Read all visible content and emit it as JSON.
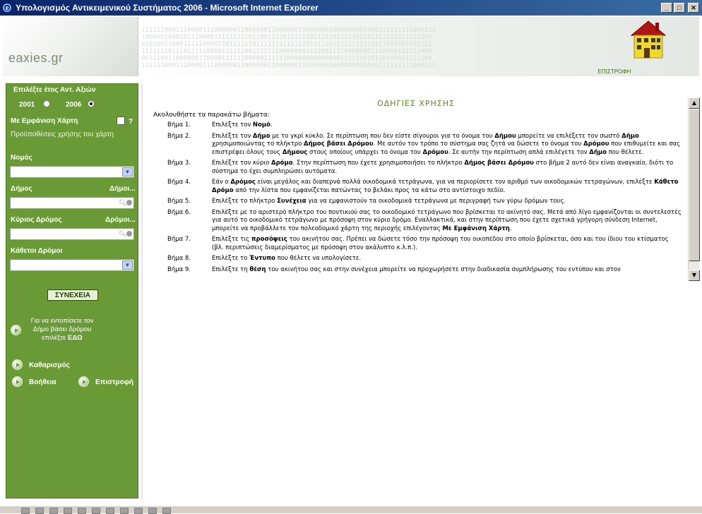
{
  "window": {
    "title": "Υπολογισμός Αντικειμενικού Συστήματος 2006 - Microsoft Internet Explorer",
    "buttons": [
      "minimize",
      "maximize",
      "close"
    ]
  },
  "header": {
    "logo": "eaxies.gr",
    "return_label": "ΕΠΙΣΤΡΟΦΗ",
    "binary_text": "11111100011100001110000001100000011000000110000001000000001000111111111000111\n1000001000101110000111111111011001111011111101111101111101111111111011111100\n0101001100011111000011011111101111111111111011111011111111110111000101001111\n1111111011101111100001111110011111110000000111100111100000001110000111111000\n0011100110000001100001111110000011111100000000000000111111010110100011111100\n11111100011100001110000001100000011000000110000001000000001000111111111000111"
  },
  "sidebar": {
    "year_label": "Επιλέξτε έτος Αντ. Αξιών",
    "year_2001": "2001",
    "year_2006": "2006",
    "selected_year": "2006",
    "map_label": "Με Εμφάνιση Χάρτη",
    "map_help": "?",
    "map_prereq": "Προϋποθέσεις χρήσης του χάρτη",
    "nomos_label": "Νομός",
    "dimos_label": "Δήμος",
    "dimos_link": "Δήμοι...",
    "road_label": "Κύριος Δρόμος",
    "road_link": "Δρόμοι...",
    "cross_label": "Κάθετοι Δρόμοι",
    "continue_label": "ΣΥΝΕΧΕΙΑ",
    "locate_text_1": "Για να εντοπίσετε τον",
    "locate_text_2": "Δήμο βάσει δρόμου",
    "locate_text_3": "επιλέξτε",
    "locate_link": "ΕΔΩ",
    "clear_label": "Καθαρισμός",
    "help_label": "Βοήθεια",
    "return_label": "Επιστροφή"
  },
  "content": {
    "title": "ΟΔΗΓΙΕΣ ΧΡΗΣΗΣ",
    "intro": "Ακολουθήστε τα παρακάτω βήματα:",
    "steps": [
      {
        "num": "Βήμα 1.",
        "html": "Επιλέξτε τον <b>Νομό</b>."
      },
      {
        "num": "Βήμα 2.",
        "html": "Επιλέξτε τον <b>Δήμο</b> με το γκρί κύκλο. Σε περίπτωση που δεν είστε σίγουροι για το όνομα του <b>Δήμου</b> μπορείτε να επιλέξετε τον σωστό <b>Δήμο</b> χρησιμοποιώντας το πλήκτρο <b>Δήμος βάσει Δρόμου</b>. Με αυτόν τον τρόπο το σύστημα σας ζητά να δώσετε το όνομα του <b>Δρόμου</b> που επιθυμείτε και σας επιστρέφει όλους τους <b>Δήμους</b> στους οποίους υπάρχει το όνομα του <b>Δρόμου</b>. Σε αυτήν την περίπτωση απλά επιλέγετε τον <b>Δήμο</b> που θέλετε."
      },
      {
        "num": "Βήμα 3.",
        "html": "Επιλέξτε τον κύριο <b>Δρόμο</b>. Στην περίπτωση που έχετε χρησιμοποιήσει το πλήκτρο <b>Δήμος βάσει Δρόμου</b> στο βήμα 2 αυτό δεν είναι αναγκαίο, διότι το σύστημα το έχει συμπληρώσει αυτόματα."
      },
      {
        "num": "Βήμα 4.",
        "html": "Εάν ο <b>Δρόμος</b> είναι μεγάλος και διαπερνά πολλά οικοδομικά τετράγωνα, για να περιορίσετε τον αριθμό των οικοδομικών τετραγώνων, επιλέξτε <b>Κάθετο Δρόμο</b> από την λίστα που εμφανίζεται πατώντας το βελάκι προς τα κάτω στο αντίστοιχο πεδίο."
      },
      {
        "num": "Βήμα 5.",
        "html": "Επιλέξτε το πλήκτρο <b>Συνέχεια</b> για να εμφανιστούν τα οικοδομικά τετράγωνα με περιγραφή των γύρω δρόμων τους."
      },
      {
        "num": "Βήμα 6.",
        "html": "Επιλέξτε με το αριστερό πλήκτρο του ποντικιού σας το οικοδομικό τετράγωνο που βρίσκεται το ακίνητό σας. Μετά από λίγο εμφανίζονται οι συντελεστές για αυτό το οικοδομικό τετράγωνο με πρόσοψη στον κύριο δρόμο. Εναλλακτικά, και στην περίπτωση που έχετε σχετικά γρήγορη σύνδεση Internet, μπορείτε να προβάλλετε τον πολεοδομικό χάρτη της περιοχής επιλέγοντας <b>Με Εμφάνιση Χάρτη</b>."
      },
      {
        "num": "Βήμα 7.",
        "html": "Επιλέξτε τις <b>προσόψεις</b> του ακινήτου σας. Πρέπει να δώσετε τόσο την πρόσοψη του οικοπέδου στο οποίο βρίσκεται, όσο και του ίδιου του κτίσματος (βλ. περιπτώσεις διαμερίσματος με πρόσοψη στον ακάλυπτο κ.λ.π.)."
      },
      {
        "num": "Βήμα 8.",
        "html": "Επιλέξτε το <b>Έντυπο</b> που θέλετε να υπολογίσετε."
      },
      {
        "num": "Βήμα 9.",
        "html": "Επιλέξτε τη <b>θέση</b> του ακινήτου σας και στην συνέχεια μπορείτε να προχωρήσετε στην διαδικασία συμπλήρωσης του εντύπου και στον"
      }
    ]
  },
  "colors": {
    "sidebar_green": "#6a9a36",
    "title_green": "#5a8a1a",
    "titlebar_blue": "#0a246a"
  }
}
